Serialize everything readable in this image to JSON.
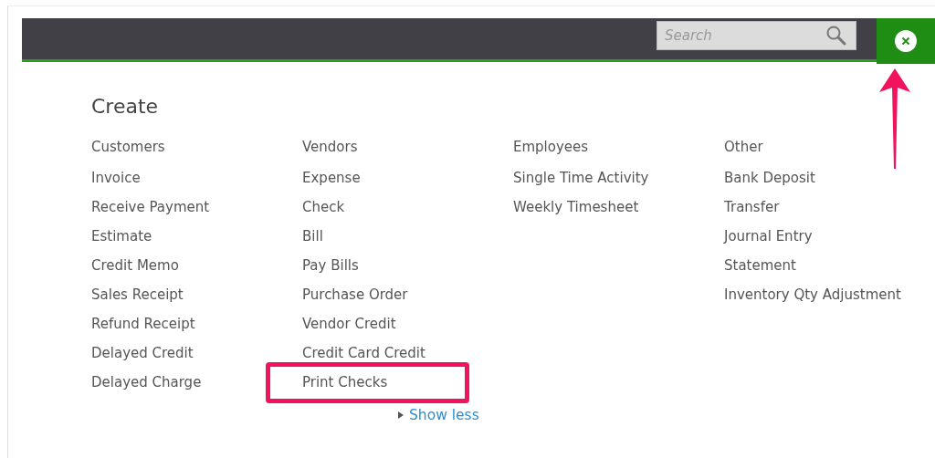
{
  "top_bar": {
    "search": {
      "placeholder": "Search"
    }
  },
  "create_menu": {
    "title": "Create",
    "columns": [
      {
        "heading": "Customers",
        "items": [
          {
            "label": "Invoice",
            "highlighted": false
          },
          {
            "label": "Receive Payment",
            "highlighted": false
          },
          {
            "label": "Estimate",
            "highlighted": false
          },
          {
            "label": "Credit Memo",
            "highlighted": false
          },
          {
            "label": "Sales Receipt",
            "highlighted": false
          },
          {
            "label": "Refund Receipt",
            "highlighted": false
          },
          {
            "label": "Delayed Credit",
            "highlighted": false
          },
          {
            "label": "Delayed Charge",
            "highlighted": false
          }
        ]
      },
      {
        "heading": "Vendors",
        "items": [
          {
            "label": "Expense",
            "highlighted": false
          },
          {
            "label": "Check",
            "highlighted": false
          },
          {
            "label": "Bill",
            "highlighted": false
          },
          {
            "label": "Pay Bills",
            "highlighted": false
          },
          {
            "label": "Purchase Order",
            "highlighted": false
          },
          {
            "label": "Vendor Credit",
            "highlighted": false
          },
          {
            "label": "Credit Card Credit",
            "highlighted": false
          },
          {
            "label": "Print Checks",
            "highlighted": true
          }
        ]
      },
      {
        "heading": "Employees",
        "items": [
          {
            "label": "Single Time Activity",
            "highlighted": false
          },
          {
            "label": "Weekly Timesheet",
            "highlighted": false
          }
        ]
      },
      {
        "heading": "Other",
        "items": [
          {
            "label": "Bank Deposit",
            "highlighted": false
          },
          {
            "label": "Transfer",
            "highlighted": false
          },
          {
            "label": "Journal Entry",
            "highlighted": false
          },
          {
            "label": "Statement",
            "highlighted": false
          },
          {
            "label": "Inventory Qty Adjustment",
            "highlighted": false
          }
        ]
      }
    ],
    "toggle": {
      "label": "Show less",
      "expanded": true
    }
  }
}
